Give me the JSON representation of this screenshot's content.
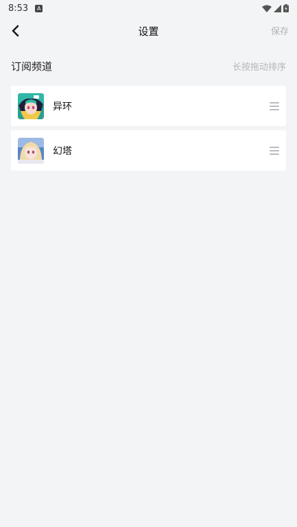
{
  "status_bar": {
    "time": "8:53",
    "app_icon": "A"
  },
  "header": {
    "title": "设置",
    "save_label": "保存",
    "back_icon": "chevron-left-icon"
  },
  "section": {
    "title": "订阅频道",
    "hint": "长按拖动排序"
  },
  "channels": [
    {
      "name": "异环",
      "thumb_icon": "anime-avatar-teal-hair"
    },
    {
      "name": "幻塔",
      "thumb_icon": "anime-avatar-blonde-hair"
    }
  ],
  "colors": {
    "background": "#f3f4f6",
    "card": "#ffffff",
    "muted": "#b0b3b8"
  }
}
